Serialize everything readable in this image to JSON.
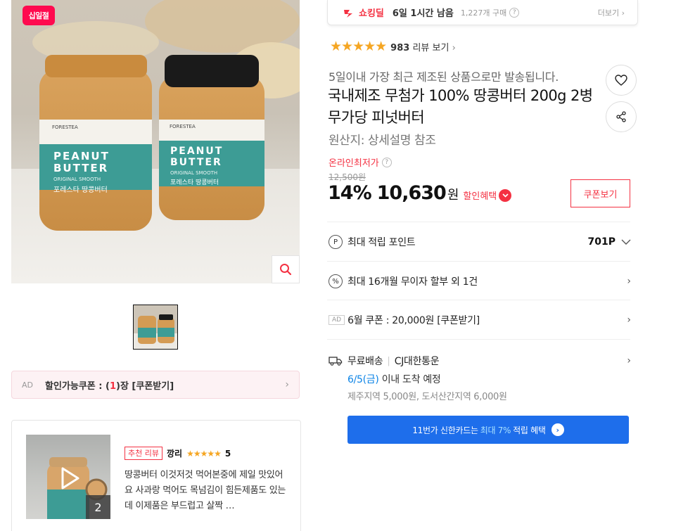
{
  "gallery": {
    "badge": "십일절",
    "main_alt": "Peanut butter jars",
    "jar_left": {
      "brand": "FORESTEA",
      "line1": "PEANUT",
      "line2": "BUTTER",
      "sub": "ORIGINAL SMOOTH",
      "kor": "포레스타 땅콩버터"
    },
    "jar_right": {
      "brand": "FORESTEA",
      "line1": "PEANUT",
      "line2": "BUTTER",
      "sub": "ORIGINAL SMOOTH",
      "kor": "포레스타 땅콩버터"
    },
    "zoom_icon": "magnifier-icon"
  },
  "coupon_bar": {
    "ad": "AD",
    "prefix": "할인가능쿠폰 : (",
    "count": "1",
    "suffix": ")장 [쿠폰받기]"
  },
  "review": {
    "badge": "추천 리뷰",
    "user": "깡리",
    "stars": "★★★★★",
    "score": "5",
    "text": "땅콩버터 이것저것 먹어본중에 제일 맛있어요 사과랑 먹어도 목넘김이 힘든제품도 있는데 이제품은 부드럽고 살짝 …",
    "media_count": "2",
    "play_icon": "play-icon"
  },
  "deal": {
    "logo": "쇼킹딜",
    "time": "6일 1시간 남음",
    "buy": "1,227개 구매",
    "info": "?",
    "more": "더보기 ›"
  },
  "rating": {
    "stars": "★★★★★",
    "count": "983",
    "label": "리뷰 보기",
    "chev": "›"
  },
  "product": {
    "subtitle": "5일이내 가장 최근 제조된 상품으로만 발송됩니다.",
    "title": "국내제조 무첨가 100% 땅콩버터 200g 2병 무가당 피넛버터",
    "origin": "원산지: 상세설명 참조"
  },
  "price": {
    "label": "온라인최저가",
    "info": "?",
    "original": "12,500원",
    "discount": "14%",
    "value": "10,630",
    "won": "원",
    "discount_link": "할인혜택",
    "coupon_button": "쿠폰보기"
  },
  "benefits": {
    "points": {
      "icon": "P",
      "label": "최대 적립 포인트",
      "value": "701P"
    },
    "installment": {
      "icon": "%",
      "label": "최대 16개월 무이자 할부 외 1건"
    },
    "coupon": {
      "ad": "AD",
      "label": "6월 쿠폰 : 20,000원 [쿠폰받기]"
    }
  },
  "shipping": {
    "label": "무료배송",
    "sep": "|",
    "carrier": "CJ대한통운",
    "date": "6/5(금)",
    "arrive_suffix": " 이내 도착 예정",
    "extra": "제주지역 5,000원, 도서산간지역 6,000원"
  },
  "card_banner": {
    "prefix": "11번가 신한카드는",
    "highlight": "최대 7%",
    "suffix": "적립 혜택",
    "arrow": "›"
  },
  "colors": {
    "accent": "#f43142",
    "banner": "#1e6eeb",
    "star": "#f5a623",
    "link_blue": "#0b83e6"
  }
}
